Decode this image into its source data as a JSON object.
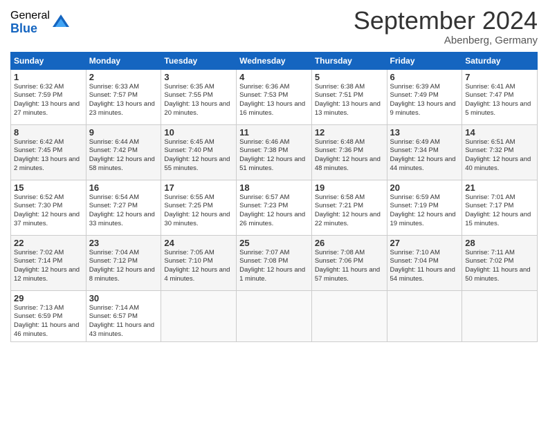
{
  "logo": {
    "general": "General",
    "blue": "Blue"
  },
  "header": {
    "month": "September 2024",
    "location": "Abenberg, Germany"
  },
  "days": [
    "Sunday",
    "Monday",
    "Tuesday",
    "Wednesday",
    "Thursday",
    "Friday",
    "Saturday"
  ],
  "weeks": [
    [
      {
        "num": "1",
        "sunrise": "6:32 AM",
        "sunset": "7:59 PM",
        "daylight": "13 hours and 27 minutes."
      },
      {
        "num": "2",
        "sunrise": "6:33 AM",
        "sunset": "7:57 PM",
        "daylight": "13 hours and 23 minutes."
      },
      {
        "num": "3",
        "sunrise": "6:35 AM",
        "sunset": "7:55 PM",
        "daylight": "13 hours and 20 minutes."
      },
      {
        "num": "4",
        "sunrise": "6:36 AM",
        "sunset": "7:53 PM",
        "daylight": "13 hours and 16 minutes."
      },
      {
        "num": "5",
        "sunrise": "6:38 AM",
        "sunset": "7:51 PM",
        "daylight": "13 hours and 13 minutes."
      },
      {
        "num": "6",
        "sunrise": "6:39 AM",
        "sunset": "7:49 PM",
        "daylight": "13 hours and 9 minutes."
      },
      {
        "num": "7",
        "sunrise": "6:41 AM",
        "sunset": "7:47 PM",
        "daylight": "13 hours and 5 minutes."
      }
    ],
    [
      {
        "num": "8",
        "sunrise": "6:42 AM",
        "sunset": "7:45 PM",
        "daylight": "13 hours and 2 minutes."
      },
      {
        "num": "9",
        "sunrise": "6:44 AM",
        "sunset": "7:42 PM",
        "daylight": "12 hours and 58 minutes."
      },
      {
        "num": "10",
        "sunrise": "6:45 AM",
        "sunset": "7:40 PM",
        "daylight": "12 hours and 55 minutes."
      },
      {
        "num": "11",
        "sunrise": "6:46 AM",
        "sunset": "7:38 PM",
        "daylight": "12 hours and 51 minutes."
      },
      {
        "num": "12",
        "sunrise": "6:48 AM",
        "sunset": "7:36 PM",
        "daylight": "12 hours and 48 minutes."
      },
      {
        "num": "13",
        "sunrise": "6:49 AM",
        "sunset": "7:34 PM",
        "daylight": "12 hours and 44 minutes."
      },
      {
        "num": "14",
        "sunrise": "6:51 AM",
        "sunset": "7:32 PM",
        "daylight": "12 hours and 40 minutes."
      }
    ],
    [
      {
        "num": "15",
        "sunrise": "6:52 AM",
        "sunset": "7:30 PM",
        "daylight": "12 hours and 37 minutes."
      },
      {
        "num": "16",
        "sunrise": "6:54 AM",
        "sunset": "7:27 PM",
        "daylight": "12 hours and 33 minutes."
      },
      {
        "num": "17",
        "sunrise": "6:55 AM",
        "sunset": "7:25 PM",
        "daylight": "12 hours and 30 minutes."
      },
      {
        "num": "18",
        "sunrise": "6:57 AM",
        "sunset": "7:23 PM",
        "daylight": "12 hours and 26 minutes."
      },
      {
        "num": "19",
        "sunrise": "6:58 AM",
        "sunset": "7:21 PM",
        "daylight": "12 hours and 22 minutes."
      },
      {
        "num": "20",
        "sunrise": "6:59 AM",
        "sunset": "7:19 PM",
        "daylight": "12 hours and 19 minutes."
      },
      {
        "num": "21",
        "sunrise": "7:01 AM",
        "sunset": "7:17 PM",
        "daylight": "12 hours and 15 minutes."
      }
    ],
    [
      {
        "num": "22",
        "sunrise": "7:02 AM",
        "sunset": "7:14 PM",
        "daylight": "12 hours and 12 minutes."
      },
      {
        "num": "23",
        "sunrise": "7:04 AM",
        "sunset": "7:12 PM",
        "daylight": "12 hours and 8 minutes."
      },
      {
        "num": "24",
        "sunrise": "7:05 AM",
        "sunset": "7:10 PM",
        "daylight": "12 hours and 4 minutes."
      },
      {
        "num": "25",
        "sunrise": "7:07 AM",
        "sunset": "7:08 PM",
        "daylight": "12 hours and 1 minute."
      },
      {
        "num": "26",
        "sunrise": "7:08 AM",
        "sunset": "7:06 PM",
        "daylight": "11 hours and 57 minutes."
      },
      {
        "num": "27",
        "sunrise": "7:10 AM",
        "sunset": "7:04 PM",
        "daylight": "11 hours and 54 minutes."
      },
      {
        "num": "28",
        "sunrise": "7:11 AM",
        "sunset": "7:02 PM",
        "daylight": "11 hours and 50 minutes."
      }
    ],
    [
      {
        "num": "29",
        "sunrise": "7:13 AM",
        "sunset": "6:59 PM",
        "daylight": "11 hours and 46 minutes."
      },
      {
        "num": "30",
        "sunrise": "7:14 AM",
        "sunset": "6:57 PM",
        "daylight": "11 hours and 43 minutes."
      },
      null,
      null,
      null,
      null,
      null
    ]
  ]
}
